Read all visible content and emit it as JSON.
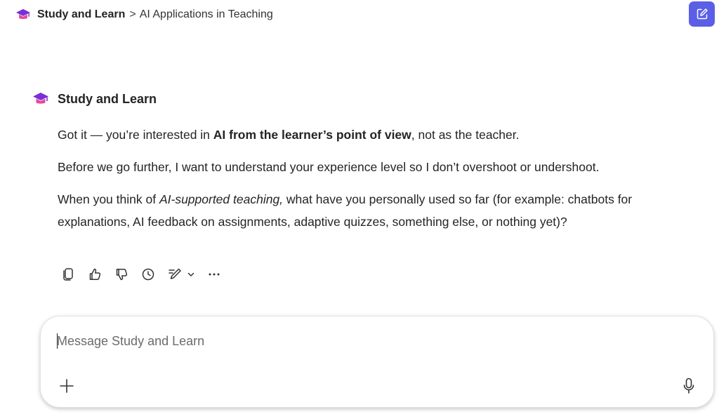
{
  "breadcrumb": {
    "root_label": "Study and Learn",
    "separator": ">",
    "current_label": "AI Applications in Teaching"
  },
  "header": {
    "new_chat_icon": "compose-icon",
    "accent_color": "#5b5fe6"
  },
  "agent": {
    "name": "Study and Learn",
    "icon": "graduation-cap-icon"
  },
  "message": {
    "p1_pre": "Got it — you’re interested in ",
    "p1_bold": "AI from the learner’s point of view",
    "p1_post": ", not as the teacher.",
    "p2": "Before we go further, I want to understand your experience level so I don’t overshoot or undershoot.",
    "p3_pre": "When you think of ",
    "p3_italic": "AI-supported teaching,",
    "p3_post": " what have you personally used so far (for example: chatbots for explanations, AI feedback on assignments, adaptive quizzes, something else, or nothing yet)?"
  },
  "actions": [
    "copy-icon",
    "thumbs-up-icon",
    "thumbs-down-icon",
    "history-icon",
    "edit-icon",
    "chevron-down-icon",
    "more-icon"
  ],
  "composer": {
    "placeholder": "Message Study and Learn",
    "value": "",
    "add_icon": "plus-icon",
    "mic_icon": "microphone-icon"
  }
}
